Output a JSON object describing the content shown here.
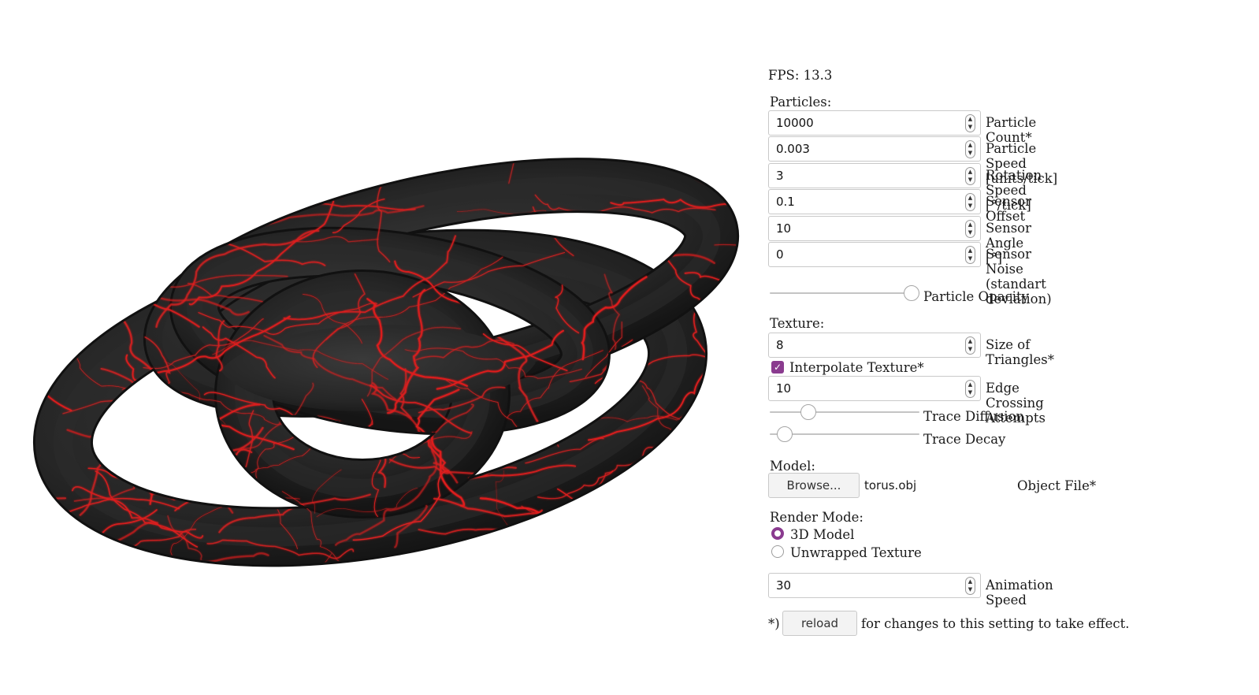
{
  "fps_text": "FPS: 13.3",
  "particles": {
    "heading": "Particles:",
    "fields": [
      {
        "value": "10000",
        "label": "Particle Count*"
      },
      {
        "value": "0.003",
        "label": "Particle Speed [units/tick]"
      },
      {
        "value": "3",
        "label": "Rotation Speed [°/tick]"
      },
      {
        "value": "0.1",
        "label": "Sensor Offset"
      },
      {
        "value": "10",
        "label": "Sensor Angle [°]"
      },
      {
        "value": "0",
        "label": "Sensor Noise (standart deviation)"
      }
    ],
    "opacity": {
      "label": "Particle Opacity",
      "level": 1.0
    }
  },
  "texture": {
    "heading": "Texture:",
    "triangle_size": {
      "value": "8",
      "label": "Size of Triangles*"
    },
    "interpolate": {
      "label": "Interpolate Texture*",
      "checked": true
    },
    "edge_crossing": {
      "value": "10",
      "label": "Edge Crossing Attempts"
    },
    "diffusion": {
      "label": "Trace Diffusion",
      "level": 0.23
    },
    "decay": {
      "label": "Trace Decay",
      "level": 0.05
    }
  },
  "model": {
    "heading": "Model:",
    "browse_label": "Browse...",
    "file_name": "torus.obj",
    "label": "Object File*"
  },
  "render_mode": {
    "heading": "Render Mode:",
    "options": [
      {
        "label": "3D Model",
        "selected": true
      },
      {
        "label": "Unwrapped Texture",
        "selected": false
      }
    ]
  },
  "animation_speed": {
    "value": "30",
    "label": "Animation Speed"
  },
  "footer": {
    "prefix": "*)",
    "reload_label": "reload",
    "suffix": "for changes to this setting to take effect."
  },
  "colors": {
    "surface": "#2b2b2b",
    "trace": "#e01f1f",
    "accent": "#8a3b8f"
  }
}
